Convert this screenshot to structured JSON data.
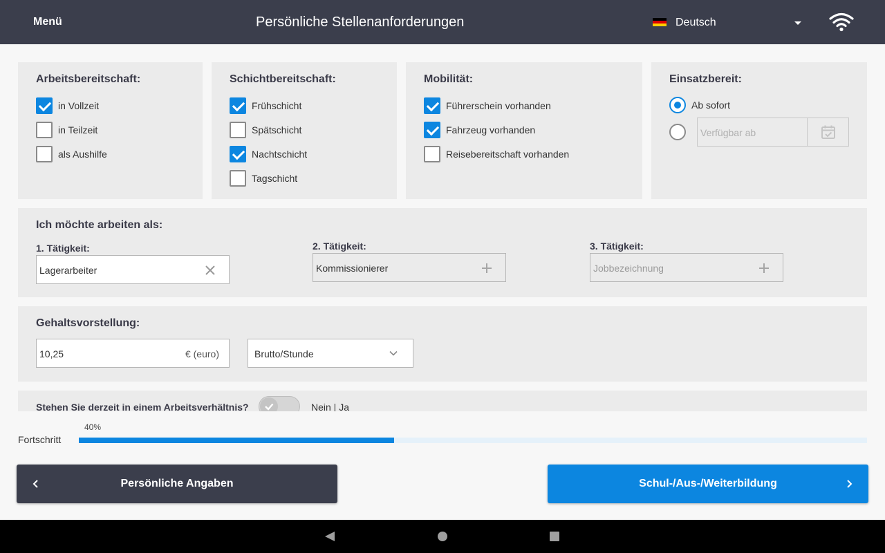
{
  "header": {
    "menu_label": "Menü",
    "title": "Persönliche Stellenanforderungen",
    "language": "Deutsch",
    "flag_icon": "germany-flag-icon",
    "wifi_icon": "wifi-icon"
  },
  "availability": {
    "title": "Arbeitsbereitschaft:",
    "options": [
      {
        "label": "in Vollzeit",
        "checked": true
      },
      {
        "label": "in Teilzeit",
        "checked": false
      },
      {
        "label": "als Aushilfe",
        "checked": false
      }
    ]
  },
  "shifts": {
    "title": "Schichtbereitschaft:",
    "options": [
      {
        "label": "Frühschicht",
        "checked": true
      },
      {
        "label": "Spätschicht",
        "checked": false
      },
      {
        "label": "Nachtschicht",
        "checked": true
      },
      {
        "label": "Tagschicht",
        "checked": false
      }
    ]
  },
  "mobility": {
    "title": "Mobilität:",
    "options": [
      {
        "label": "Führerschein vorhanden",
        "checked": true
      },
      {
        "label": "Fahrzeug vorhanden",
        "checked": true
      },
      {
        "label": "Reisebereitschaft vorhanden",
        "checked": false
      }
    ]
  },
  "start": {
    "title": "Einsatzbereit:",
    "immediately_label": "Ab sofort",
    "selected": "immediately",
    "date_placeholder": "Verfügbar ab",
    "calendar_icon": "calendar-icon"
  },
  "jobs": {
    "title": "Ich möchte arbeiten als:",
    "items": [
      {
        "label": "1. Tätigkeit:",
        "value": "Lagerarbeiter",
        "placeholder": "",
        "action_icon": "clear-icon"
      },
      {
        "label": "2. Tätigkeit:",
        "value": "Kommissionierer",
        "placeholder": "",
        "action_icon": "plus-icon"
      },
      {
        "label": "3. Tätigkeit:",
        "value": "",
        "placeholder": "Jobbezeichnung",
        "action_icon": "plus-icon"
      }
    ]
  },
  "salary": {
    "title": "Gehaltsvorstellung:",
    "value": "10,25",
    "unit": "€ (euro)",
    "period": "Brutto/Stunde"
  },
  "employment": {
    "question": "Stehen Sie derzeit in einem Arbeitsverhältnis?",
    "toggle_label": "Nein | Ja",
    "toggle_value": "Nein"
  },
  "progress": {
    "label": "Fortschritt",
    "percent_text": "40%",
    "value": 0.4
  },
  "nav": {
    "back_label": "Persönliche Angaben",
    "next_label": "Schul-/Aus-/Weiterbildung"
  },
  "colors": {
    "header_bg": "#3b3e4c",
    "accent": "#0c86e0",
    "panel_bg": "#ebebeb",
    "back_button_bg": "#3b3e4c"
  }
}
